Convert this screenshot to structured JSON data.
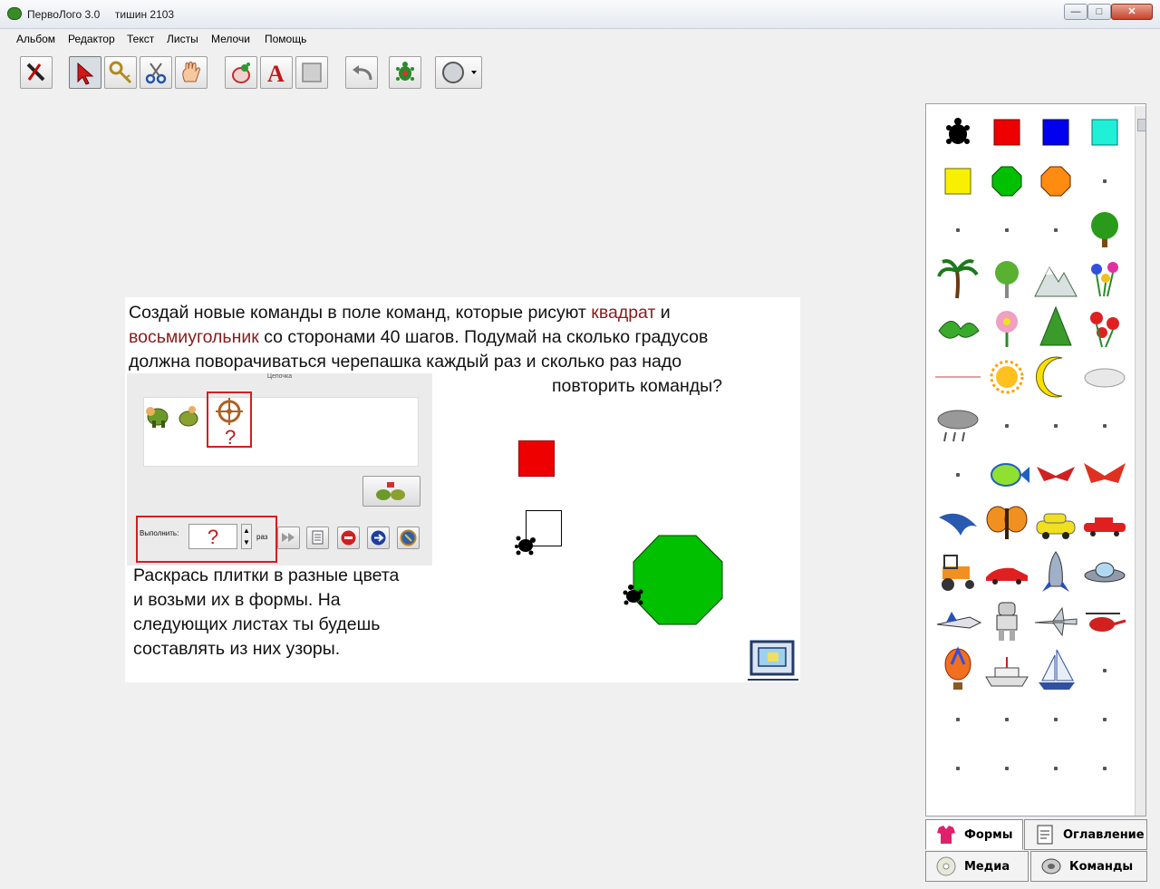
{
  "window": {
    "title": "ПервоЛого 3.0     тишин 2103",
    "controls": {
      "minimize": "—",
      "maximize": "□",
      "close": "✕"
    }
  },
  "menu": [
    "Альбом",
    "Редактор",
    "Текст",
    "Листы",
    "Мелочи",
    "Помощь"
  ],
  "toolbar": {
    "tools": [
      "brush-icon",
      "arrow-icon",
      "key-icon",
      "scissors-icon",
      "hand-icon",
      "turtle-hatch-icon",
      "text-icon",
      "rectangle-icon",
      "undo-icon",
      "turtle-icon",
      "shape-icon"
    ]
  },
  "page": {
    "line1_a": "Создай новые команды в поле команд,  которые рисуют ",
    "line1_red": "квадрат",
    "line1_b": " и",
    "line2_red": "восьмиугольник",
    "line2_b": " со сторонами 40 шагов. Подумай на сколько градусов",
    "line3": "должна поворачиваться черепашка каждый раз и сколько раз надо",
    "line4": "повторить команды?",
    "embed": {
      "title": "Цепочка",
      "run_label": "Выполнить:",
      "question": "?",
      "unit": "раз"
    },
    "bottom_text": [
      "Раскрась плитки в разные цвета",
      "и возьми их в формы. На",
      "следующих листах ты будешь",
      "составлять из них узоры."
    ],
    "colors": {
      "red_tile": "#ee0000",
      "octagon": "#00c000",
      "accent_red": "#8b1a1a"
    }
  },
  "panel": {
    "tabs": [
      {
        "label": "Формы",
        "icon": "shirt-icon"
      },
      {
        "label": "Оглавление",
        "icon": "contents-icon"
      },
      {
        "label": "Медиа",
        "icon": "disc-icon"
      },
      {
        "label": "Команды",
        "icon": "commands-icon"
      }
    ],
    "shapes": [
      "turtle",
      "red-square",
      "blue-square",
      "cyan-square",
      "yellow-square",
      "green-octagon",
      "orange-octagon",
      "empty",
      "empty",
      "empty",
      "empty",
      "tree",
      "palm",
      "birch",
      "mountain",
      "flowers",
      "leaves",
      "flower",
      "fir",
      "red-flowers",
      "note",
      "sun",
      "moon",
      "cloud",
      "rain-cloud",
      "empty",
      "empty",
      "empty",
      "empty",
      "fish",
      "bird",
      "red-bird",
      "dolphin",
      "butterfly",
      "yellow-car",
      "red-car",
      "tractor",
      "sports-car",
      "rocket",
      "ufo",
      "shuttle",
      "robot",
      "airplane",
      "helicopter",
      "balloon",
      "ship",
      "sailboat",
      "empty",
      "empty",
      "empty",
      "empty",
      "empty",
      "empty",
      "empty",
      "empty",
      "empty",
      "empty",
      "empty",
      "empty",
      "empty"
    ]
  }
}
